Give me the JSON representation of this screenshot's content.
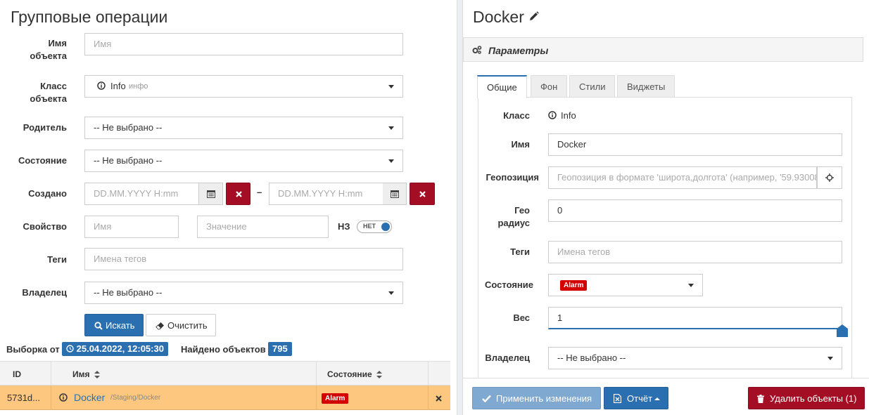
{
  "left": {
    "title": "Групповые операции",
    "labels": {
      "name_l1": "Имя",
      "name_l2": "объекта",
      "class_l1": "Класс",
      "class_l2": "объекта",
      "parent": "Родитель",
      "state": "Состояние",
      "created": "Создано",
      "property": "Свойство",
      "tags": "Теги",
      "owner": "Владелец"
    },
    "name_placeholder": "Имя",
    "class_value": "Info",
    "class_sub": "инфо",
    "not_selected": "-- Не выбрано --",
    "date_placeholder": "DD.MM.YYYY H:mm",
    "range_sep": "–",
    "prop_name_placeholder": "Имя",
    "prop_value_placeholder": "Значение",
    "nz_label": "НЗ",
    "toggle_label": "НЕТ",
    "tags_placeholder": "Имена тегов",
    "search_button": "Искать",
    "clear_button": "Очистить",
    "selection_label": "Выборка от",
    "selection_date": "25.04.2022, 12:05:30",
    "found_label": "Найдено объектов",
    "found_count": "795",
    "table": {
      "col_id": "ID",
      "col_name": "Имя",
      "col_state": "Состояние",
      "row_id": "5731d...",
      "row_name": "Docker",
      "row_path": "/Staging/Docker",
      "row_state": "Alarm"
    }
  },
  "right": {
    "title": "Docker",
    "panel_title": "Параметры",
    "tabs": [
      "Общие",
      "Фон",
      "Стили",
      "Виджеты"
    ],
    "labels": {
      "class": "Класс",
      "name": "Имя",
      "geo": "Геопозиция",
      "geo_r1": "Гео",
      "geo_r2": "радиус",
      "tags": "Теги",
      "state": "Состояние",
      "weight": "Вес",
      "owner": "Владелец"
    },
    "class_value": "Info",
    "name_value": "Docker",
    "geo_placeholder": "Геопозиция в формате 'широта,долгота' (например, '59.93008",
    "geo_radius": "0",
    "tags_placeholder": "Имена тегов",
    "state_value": "Alarm",
    "weight_value": "1",
    "owner_value": "-- Не выбрано --",
    "apply_button": "Применить изменения",
    "report_button": "Отчёт",
    "delete_button": "Удалить объекты (1)"
  },
  "colors": {
    "primary": "#2a6fb0",
    "danger": "#a30e24",
    "alarm": "#d40000",
    "row_highlight": "#fdc77f"
  }
}
